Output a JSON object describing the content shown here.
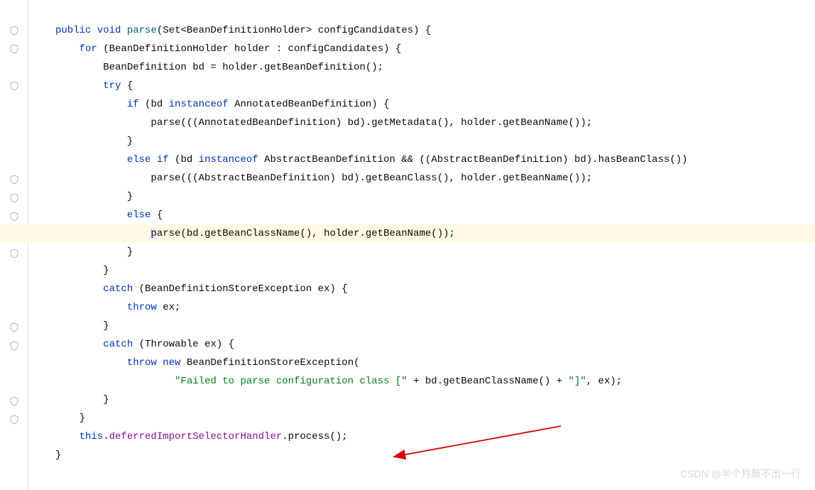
{
  "code": {
    "l1_kw_public": "public",
    "l1_kw_void": "void",
    "l1_method": "parse",
    "l1_rest": "(Set<BeanDefinitionHolder> configCandidates) {",
    "l2_kw_for": "for",
    "l2_rest": " (BeanDefinitionHolder holder : configCandidates) {",
    "l3": "        BeanDefinition bd = holder.getBeanDefinition();",
    "l4_kw_try": "try",
    "l4_rest": " {",
    "l5_kw_if": "if",
    "l5_mid": " (bd ",
    "l5_kw_instanceof": "instanceof",
    "l5_rest": " AnnotatedBeanDefinition) {",
    "l6": "                parse(((AnnotatedBeanDefinition) bd).getMetadata(), holder.getBeanName());",
    "l7": "            }",
    "l8_kw_else": "else",
    "l8_sp": " ",
    "l8_kw_if": "if",
    "l8_mid": " (bd ",
    "l8_kw_instanceof": "instanceof",
    "l8_rest": " AbstractBeanDefinition && ((AbstractBeanDefinition) bd).hasBeanClass())",
    "l9": "                parse(((AbstractBeanDefinition) bd).getBeanClass(), holder.getBeanName());",
    "l10": "            }",
    "l11_kw_else": "else",
    "l11_rest": " {",
    "l12_indent": "                ",
    "l12_rest": "parse(bd.getBeanClassName(), holder.getBeanName());",
    "l13": "            }",
    "l14": "        }",
    "l15_kw_catch": "catch",
    "l15_rest": " (BeanDefinitionStoreException ex) {",
    "l16_kw_throw": "throw",
    "l16_rest": " ex;",
    "l17": "        }",
    "l18_kw_catch": "catch",
    "l18_rest": " (Throwable ex) {",
    "l19_kw_throw": "throw",
    "l19_sp": " ",
    "l19_kw_new": "new",
    "l19_rest": " BeanDefinitionStoreException(",
    "l20_indent": "                    ",
    "l20_str1": "\"Failed to parse configuration class [\"",
    "l20_mid": " + bd.getBeanClassName() + ",
    "l20_str2": "\"]\"",
    "l20_rest": ", ex);",
    "l21": "        }",
    "l22": "    }",
    "l23": "",
    "l24_kw_this": "this",
    "l24_dot": ".",
    "l24_field": "deferredImportSelectorHandler",
    "l24_rest": ".process();",
    "l25": "}"
  },
  "watermark": "CSDN @半个月敲不出一行",
  "gutter_icon_positions": [
    34,
    60,
    112,
    244,
    270,
    296,
    348,
    452,
    478,
    556,
    582
  ]
}
